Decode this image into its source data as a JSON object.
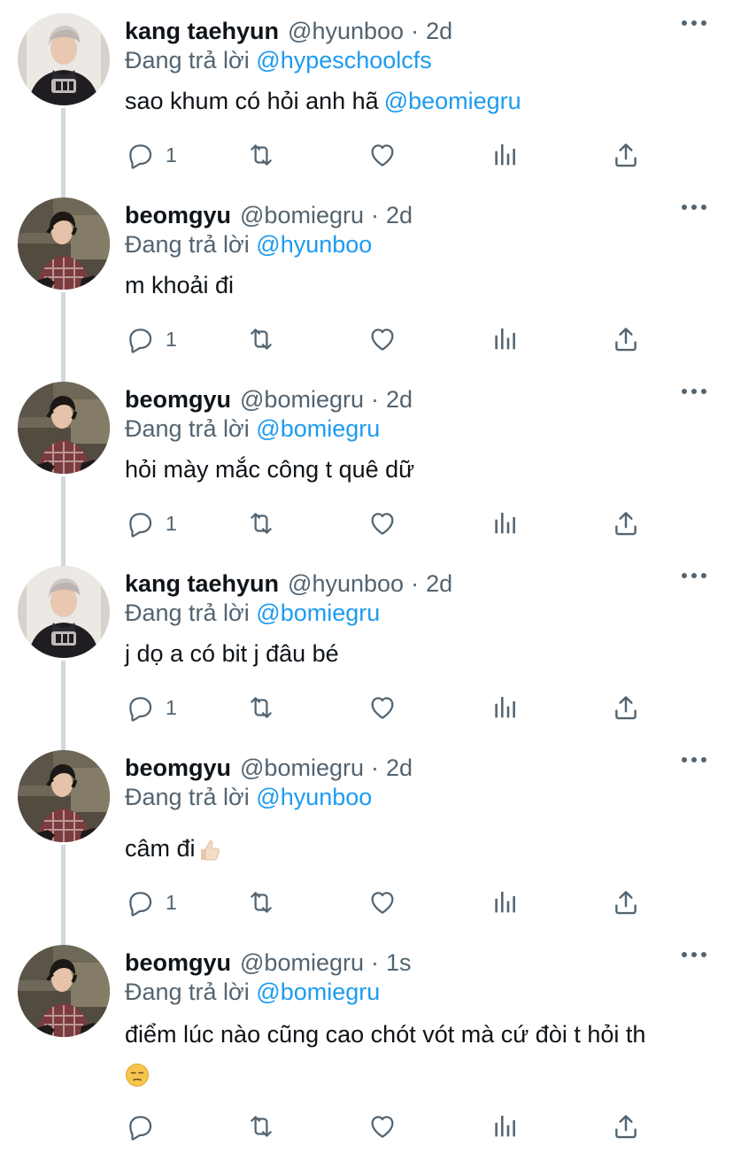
{
  "thread": {
    "tweets": [
      {
        "name": "kang taehyun",
        "handle": "@hyunboo",
        "time": "2d",
        "reply_prefix": "Đang trả lời",
        "reply_to": "@hypeschoolcfs",
        "text": "sao khum có hỏi anh hã",
        "text_mention": "@beomiegru",
        "reply_count": "1",
        "avatar": "avatar-kang-taehyun"
      },
      {
        "name": "beomgyu",
        "handle": "@bomiegru",
        "time": "2d",
        "reply_prefix": "Đang trả lời",
        "reply_to": "@hyunboo",
        "text": "m khoải đi",
        "reply_count": "1",
        "avatar": "avatar-beomgyu"
      },
      {
        "name": "beomgyu",
        "handle": "@bomiegru",
        "time": "2d",
        "reply_prefix": "Đang trả lời",
        "reply_to": "@bomiegru",
        "text": "hỏi mày mắc công t quê dữ",
        "reply_count": "1",
        "avatar": "avatar-beomgyu"
      },
      {
        "name": "kang taehyun",
        "handle": "@hyunboo",
        "time": "2d",
        "reply_prefix": "Đang trả lời",
        "reply_to": "@bomiegru",
        "text": "j dọ a có bit j đâu bé",
        "reply_count": "1",
        "avatar": "avatar-kang-taehyun"
      },
      {
        "name": "beomgyu",
        "handle": "@bomiegru",
        "time": "2d",
        "reply_prefix": "Đang trả lời",
        "reply_to": "@hyunboo",
        "text": "câm đi",
        "text_emoji": "thumbs-up-emoji",
        "reply_count": "1",
        "avatar": "avatar-beomgyu"
      },
      {
        "name": "beomgyu",
        "handle": "@bomiegru",
        "time": "1s",
        "reply_prefix": "Đang trả lời",
        "reply_to": "@bomiegru",
        "text": "điểm lúc nào cũng cao chót vót mà cứ đòi t hỏi th",
        "text_emoji": "unamused-face-emoji",
        "reply_count": "",
        "avatar": "avatar-beomgyu"
      }
    ]
  },
  "icons": {
    "reply": "reply-icon",
    "retweet": "retweet-icon",
    "like": "heart-icon",
    "views": "views-icon",
    "share": "share-icon",
    "more": "more-icon"
  },
  "colors": {
    "text": "#0f1419",
    "secondary": "#536471",
    "link": "#1d9bf0",
    "thread_line": "#cfd9de"
  }
}
